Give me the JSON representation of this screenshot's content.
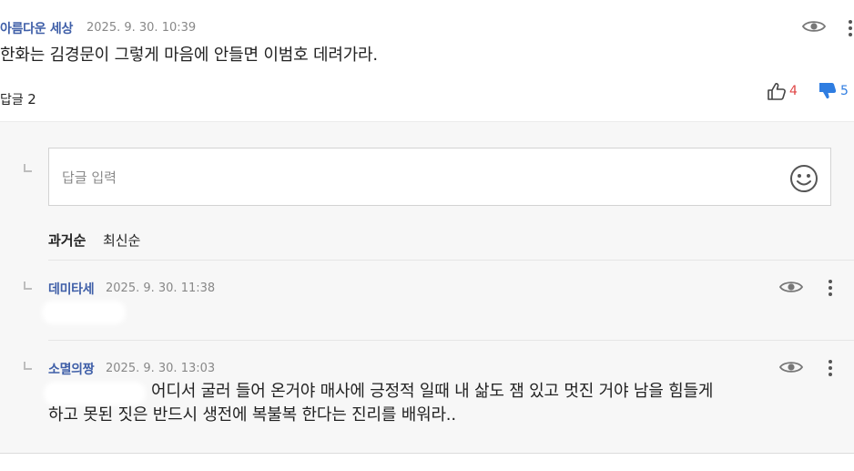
{
  "comment": {
    "author": "아름다운 세상",
    "date": "2025. 9. 30. 10:39",
    "text": "한화는 김경문이 그렇게 마음에 안들면 이범호 데려가라.",
    "reply_label": "답글",
    "reply_count": "2",
    "likes": "4",
    "dislikes": "5"
  },
  "reply_input": {
    "placeholder": "답글 입력"
  },
  "sort": {
    "oldest": "과거순",
    "newest": "최신순"
  },
  "replies": [
    {
      "author": "데미타세",
      "date": "2025. 9. 30. 11:38",
      "text": ""
    },
    {
      "author": "소멸의짱",
      "date": "2025. 9. 30. 13:03",
      "text_line1": "어디서 굴러 들어 온거야 매사에 긍정적 일때 내 삶도 잼 있고 멋진 거야 남을 힘들게",
      "text_line2": "하고 못된 짓은 반드시 생전에 복불복 한다는 진리를 배워라.."
    }
  ],
  "colors": {
    "author": "#3f5fa8",
    "like": "#e04646",
    "dislike": "#2f7de1",
    "reply_bg": "#f7f7f7"
  },
  "icons": {
    "view": "eye-icon",
    "more": "more-vertical-icon",
    "like": "thumbs-up-icon",
    "dislike": "thumbs-down-icon",
    "emoji": "smiley-icon",
    "reply_marker": "reply-corner-icon"
  }
}
